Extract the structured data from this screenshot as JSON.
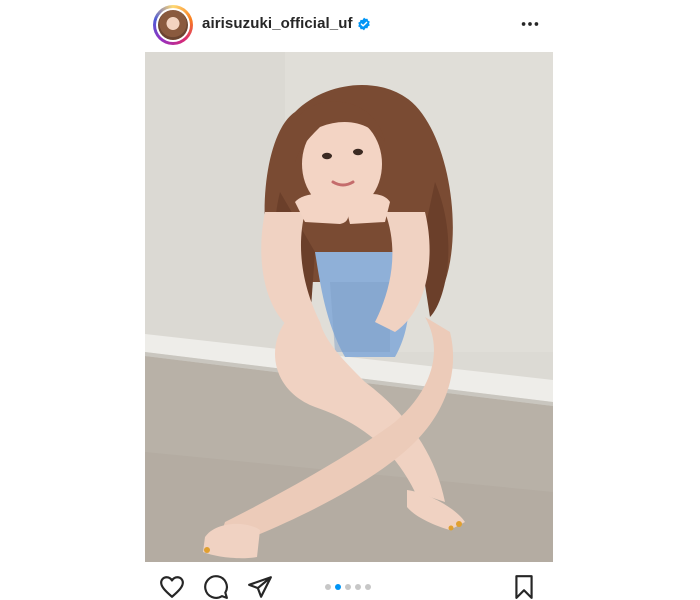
{
  "post": {
    "username": "airisuzuki_official_uf",
    "verified": true,
    "carousel": {
      "count": 5,
      "active_index": 1
    }
  },
  "icons": {
    "verified": "verified-badge-icon",
    "more": "more-options-icon",
    "like": "heart-icon",
    "comment": "comment-icon",
    "share": "paper-plane-icon",
    "save": "bookmark-icon"
  },
  "colors": {
    "accent": "#0095f6",
    "text": "#262626",
    "dot_inactive": "#c7c7c7"
  }
}
